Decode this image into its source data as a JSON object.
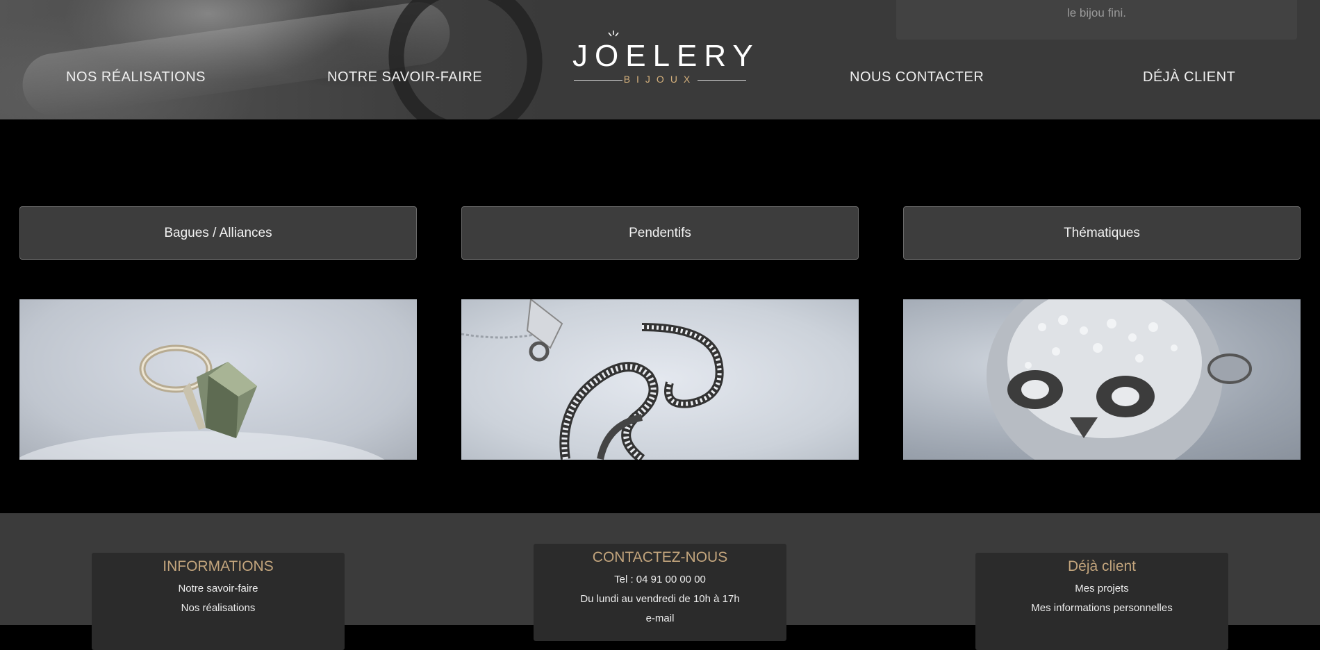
{
  "header": {
    "quote_text": "le bijou fini.",
    "nav": [
      {
        "label": "NOS RÉALISATIONS"
      },
      {
        "label": "NOTRE SAVOIR-FAIRE"
      },
      {
        "label": "NOUS CONTACTER"
      },
      {
        "label": "DÉJÀ CLIENT"
      }
    ],
    "logo": {
      "word": "JOELERY",
      "sub": "BIJOUX"
    }
  },
  "categories": [
    {
      "label": "Bagues / Alliances",
      "image": "ring-photo"
    },
    {
      "label": "Pendentifs",
      "image": "pendant-photo"
    },
    {
      "label": "Thématiques",
      "image": "skull-ring-photo"
    }
  ],
  "footer": {
    "informations": {
      "title": "INFORMATIONS",
      "links": [
        "Notre savoir-faire",
        "Nos réalisations"
      ]
    },
    "contact": {
      "title": "CONTACTEZ-NOUS",
      "lines": [
        "Tel : 04 91 00 00 00",
        "Du lundi au vendredi de 10h à 17h",
        "e-mail"
      ]
    },
    "client": {
      "title": "Déjà client",
      "links": [
        "Mes projets",
        "Mes informations personnelles"
      ]
    }
  },
  "colors": {
    "accent_gold": "#c3a57d",
    "logo_gold": "#d4b07c",
    "background": "#000000",
    "panel": "#3d3d3d"
  }
}
